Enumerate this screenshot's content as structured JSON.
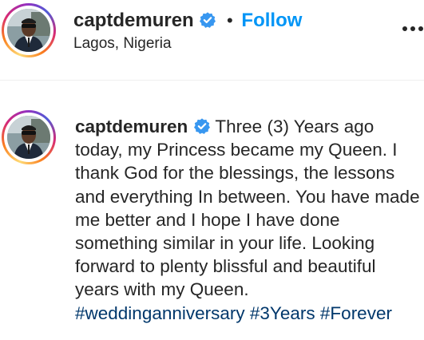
{
  "post_header": {
    "username": "captdemuren",
    "separator": "•",
    "follow_label": "Follow",
    "location": "Lagos, Nigeria"
  },
  "caption": {
    "username": "captdemuren",
    "text": "Three (3) Years ago today, my Princess became my Queen. I thank God for the blessings, the lessons and everything In between. You have made me better and I hope I have done something similar in your life. Looking forward to plenty blissful and beautiful years with my Queen.",
    "hashtags": [
      "#weddinganniversary",
      "#3Years",
      "#Forever"
    ]
  },
  "colors": {
    "accent_blue": "#0095f6",
    "hashtag_blue": "#00376b",
    "verified_blue": "#3897f0",
    "text": "#262626"
  },
  "icons": {
    "verified": "verified-badge-icon",
    "more": "more-options-icon"
  }
}
